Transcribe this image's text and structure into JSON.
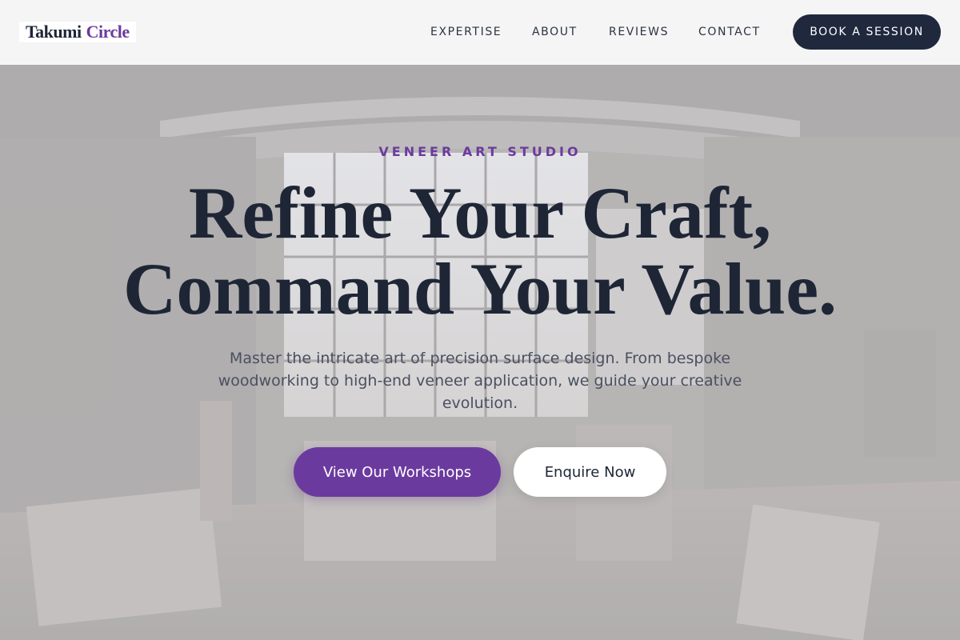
{
  "brand": {
    "word1": "Takumi",
    "word2": "Circle"
  },
  "nav": {
    "items": [
      {
        "label": "EXPERTISE"
      },
      {
        "label": "ABOUT"
      },
      {
        "label": "REVIEWS"
      },
      {
        "label": "CONTACT"
      }
    ],
    "cta_label": "BOOK A SESSION"
  },
  "hero": {
    "eyebrow": "VENEER ART STUDIO",
    "headline_line1": "Refine Your Craft,",
    "headline_line2": "Command Your Value.",
    "subtitle": "Master the intricate art of precision surface design. From bespoke woodworking to high-end veneer application, we guide your creative evolution.",
    "primary_button": "View Our Workshops",
    "secondary_button": "Enquire Now"
  },
  "colors": {
    "accent": "#6b3a9e",
    "navy": "#1f283d",
    "header_bg": "#f5f5f5"
  }
}
